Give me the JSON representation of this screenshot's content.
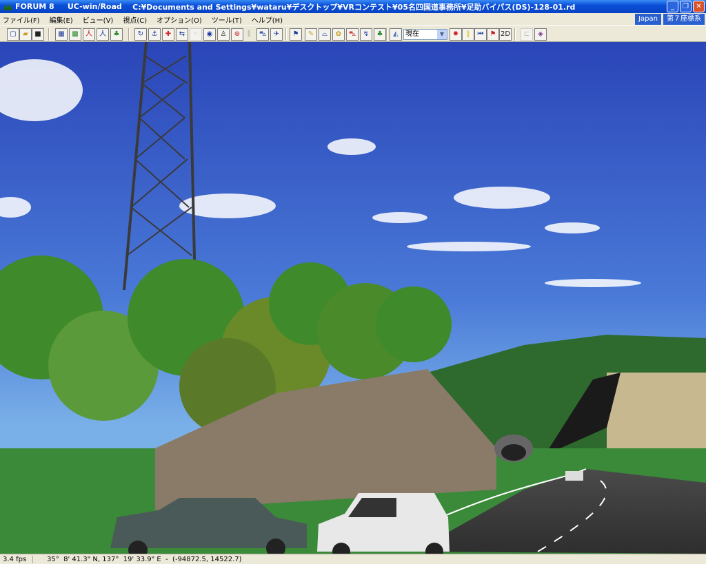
{
  "window": {
    "app": "FORUM 8",
    "product": "UC-win/Road",
    "path": "C:¥Documents and Settings¥wataru¥デスクトップ¥VRコンテスト¥05名四国道事務所¥足助バイパス(DS)-128-01.rd"
  },
  "menu": [
    "ファイル(F)",
    "編集(E)",
    "ビュー(V)",
    "視点(C)",
    "オプション(O)",
    "ツール(T)",
    "ヘルプ(H)"
  ],
  "region": {
    "country": "Japan",
    "coord_system": "第７座標系"
  },
  "toolbar": {
    "time_select": "現在",
    "btn_2d": "2D"
  },
  "status": {
    "fps": "3.4 fps",
    "coords": "35°  8' 41.3\" N, 137°  19' 33.9\" E  -  (-94872.5, 14522.7)"
  }
}
